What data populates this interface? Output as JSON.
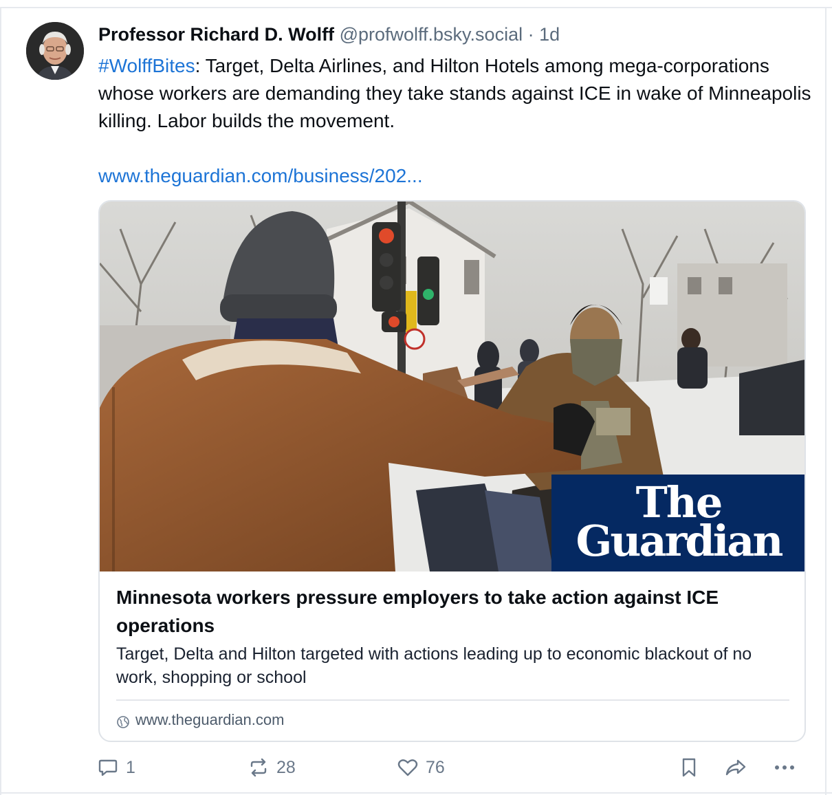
{
  "post": {
    "author_name": "Professor Richard D. Wolff",
    "author_handle": "@profwolff.bsky.social",
    "separator": "·",
    "time": "1d",
    "hashtag": "#WolffBites",
    "text": ": Target, Delta Airlines, and Hilton Hotels among mega-corporations whose workers are demanding they take stands against ICE in wake of Minneapolis killing. Labor builds the movement.",
    "link": "www.theguardian.com/business/202..."
  },
  "card": {
    "badge_line1": "The",
    "badge_line2": "Guardian",
    "title": "Minnesota workers pressure employers to take action against ICE operations",
    "description": "Target, Delta and Hilton targeted with actions leading up to economic blackout of no work, shopping or school",
    "domain": "www.theguardian.com",
    "domain_icon": "globe-icon"
  },
  "actions": {
    "reply": {
      "icon": "reply-icon",
      "count": "1"
    },
    "repost": {
      "icon": "repost-icon",
      "count": "28"
    },
    "like": {
      "icon": "heart-icon",
      "count": "76"
    },
    "bookmark": {
      "icon": "bookmark-icon"
    },
    "share": {
      "icon": "share-icon"
    },
    "more": {
      "icon": "more-icon"
    }
  },
  "colors": {
    "link": "#1d74d6",
    "muted": "#5b6b7c",
    "guardian_blue": "#052962",
    "border": "#dfe3e8"
  }
}
